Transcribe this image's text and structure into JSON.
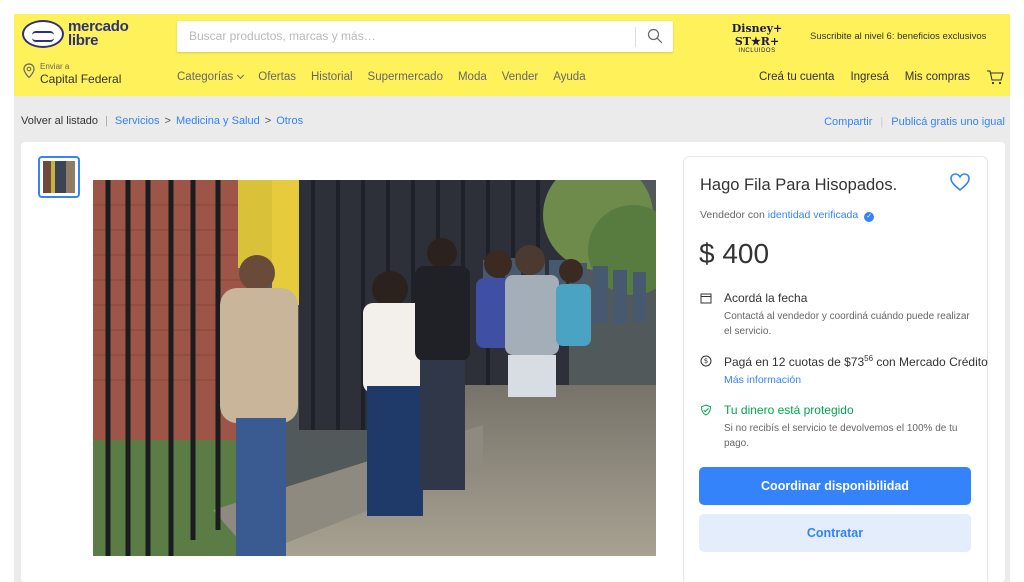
{
  "header": {
    "logo_line1": "mercado",
    "logo_line2": "libre",
    "search_placeholder": "Buscar productos, marcas y más…",
    "promo_brand": "Disney+ ST★R+",
    "promo_brand_sub": "INCLUIDOS",
    "promo_text": "Suscribite al nivel 6: beneficios exclusivos",
    "location_small": "Enviar a",
    "location_main": "Capital Federal",
    "nav": [
      "Categorías",
      "Ofertas",
      "Historial",
      "Supermercado",
      "Moda",
      "Vender",
      "Ayuda"
    ],
    "account": [
      "Creá tu cuenta",
      "Ingresá",
      "Mis compras"
    ]
  },
  "breadcrumb": {
    "back": "Volver al listado",
    "items": [
      "Servicios",
      "Medicina y Salud",
      "Otros"
    ],
    "share": "Compartir",
    "publish": "Publicá gratis uno igual"
  },
  "product": {
    "title": "Hago Fila Para Hisopados.",
    "seller_prefix": "Vendedor con",
    "seller_link": "identidad verificada",
    "price": "$ 400",
    "date_title": "Acordá la fecha",
    "date_body": "Contactá al vendedor y coordiná cuándo puede realizar el servicio.",
    "installments_prefix": "Pagá en 12 cuotas de $73",
    "installments_cents": "56",
    "installments_suffix": " con Mercado Crédito",
    "more_info": "Más información",
    "protected_title": "Tu dinero está protegido",
    "protected_body": "Si no recibís el servicio te devolvemos el 100% de tu pago.",
    "primary_button": "Coordinar disponibilidad",
    "secondary_button": "Contratar"
  },
  "colors": {
    "brand_yellow": "#fff159",
    "link_blue": "#3483fa",
    "protected_green": "#00a650"
  },
  "icons": [
    "search-icon",
    "location-pin-icon",
    "cart-icon",
    "heart-icon",
    "calendar-icon",
    "dollar-icon",
    "shield-check-icon"
  ]
}
